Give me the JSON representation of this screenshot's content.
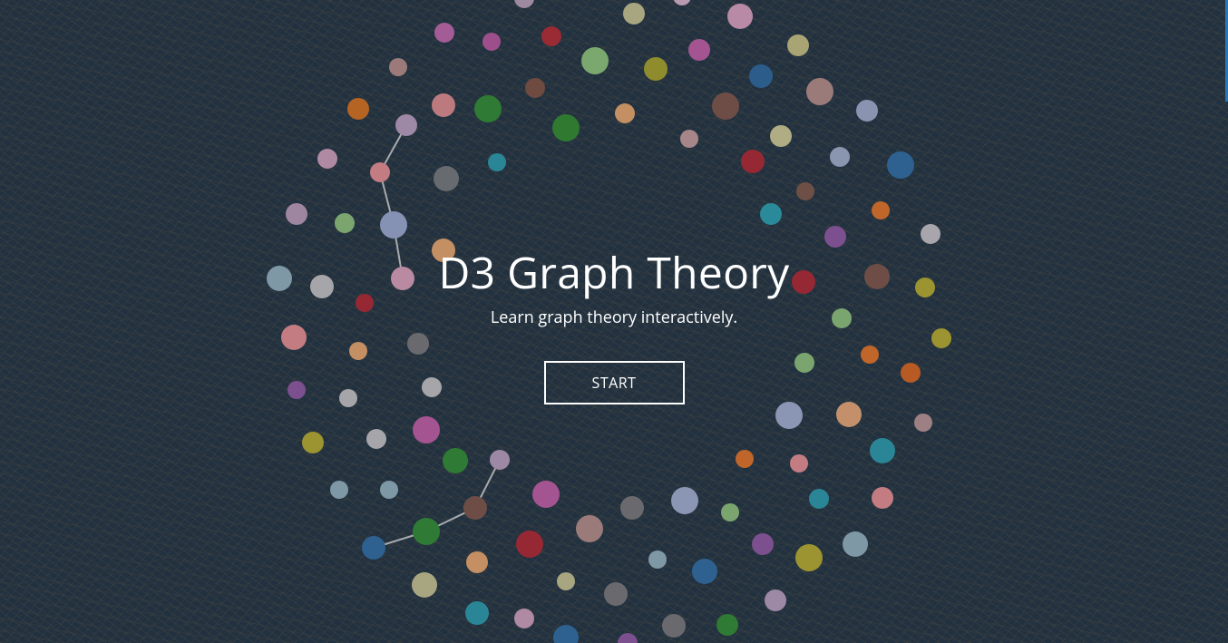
{
  "hero": {
    "title": "D3 Graph Theory",
    "subtitle": "Learn graph theory interactively.",
    "start_label": "START"
  },
  "colors": {
    "background": "#223140",
    "text": "#ffffff",
    "edge": "#c8c8c8",
    "scrollbar_accent": "#2b78b8"
  }
}
